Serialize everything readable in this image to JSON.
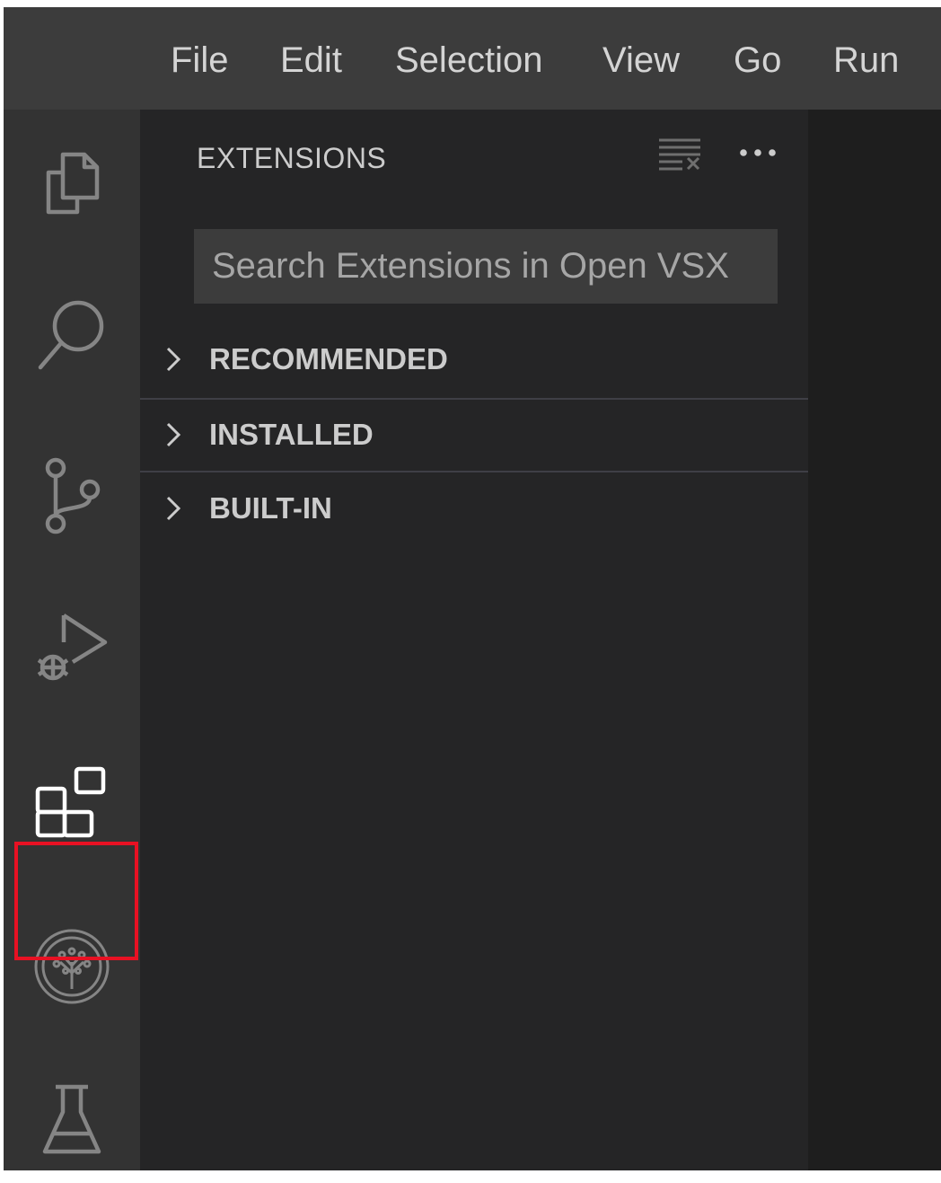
{
  "menubar": {
    "items": [
      "File",
      "Edit",
      "Selection",
      "View",
      "Go",
      "Run"
    ]
  },
  "activity_bar": {
    "items": [
      {
        "name": "explorer",
        "icon": "files-icon",
        "active": false
      },
      {
        "name": "search",
        "icon": "search-icon",
        "active": false
      },
      {
        "name": "source-control",
        "icon": "source-control-icon",
        "active": false
      },
      {
        "name": "run-debug",
        "icon": "run-debug-icon",
        "active": false
      },
      {
        "name": "extensions",
        "icon": "extensions-icon",
        "active": true,
        "highlighted": true
      },
      {
        "name": "tree-view",
        "icon": "tree-circle-icon",
        "active": false
      },
      {
        "name": "testing",
        "icon": "beaker-icon",
        "active": false
      }
    ],
    "highlight_color": "#e81123"
  },
  "sidebar": {
    "title": "EXTENSIONS",
    "actions": [
      {
        "name": "clear-search",
        "icon": "clear-all-icon"
      },
      {
        "name": "more-actions",
        "icon": "ellipsis-icon",
        "label": "···"
      }
    ],
    "search": {
      "placeholder": "Search Extensions in Open VSX",
      "value": ""
    },
    "sections": [
      {
        "label": "RECOMMENDED",
        "expanded": false
      },
      {
        "label": "INSTALLED",
        "expanded": false
      },
      {
        "label": "BUILT-IN",
        "expanded": false
      }
    ]
  },
  "colors": {
    "menubar_bg": "#3c3c3c",
    "activitybar_bg": "#333333",
    "sidebar_bg": "#252526",
    "editor_bg": "#1e1e1e"
  }
}
